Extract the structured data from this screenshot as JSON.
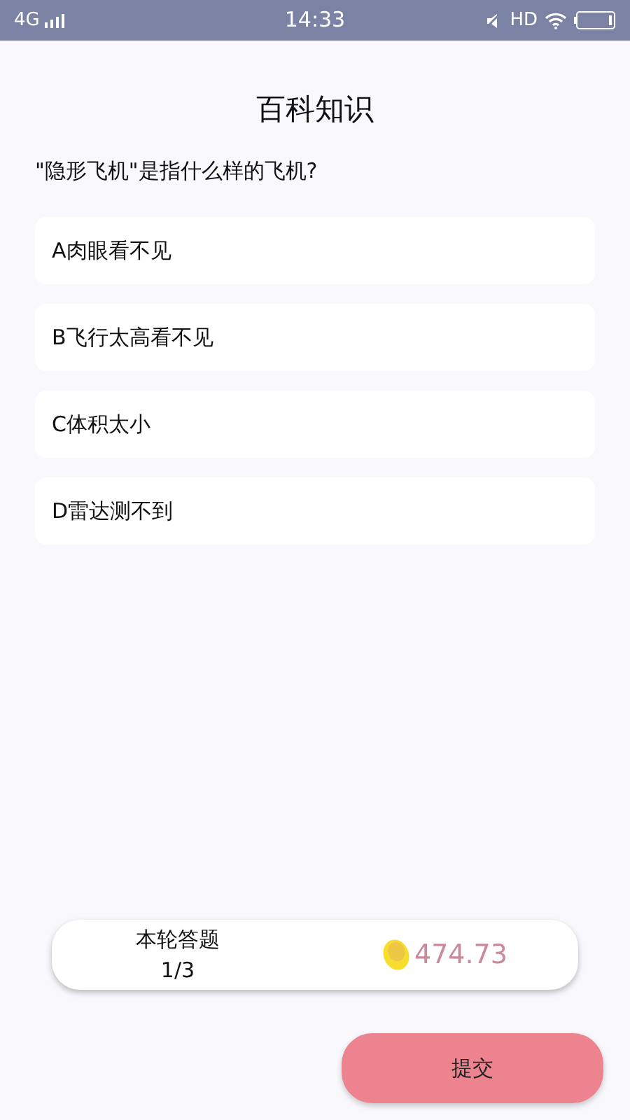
{
  "status_bar": {
    "network": "4G",
    "time": "14:33",
    "hd": "HD"
  },
  "title": "百科知识",
  "question": "\"隐形飞机\"是指什么样的飞机?",
  "options": [
    {
      "text": "A肉眼看不见"
    },
    {
      "text": "B飞行太高看不见"
    },
    {
      "text": "C体积太小"
    },
    {
      "text": "D雷达测不到"
    }
  ],
  "progress": {
    "label": "本轮答题",
    "count": "1/3",
    "coins": "474.73"
  },
  "submit_button": "提交"
}
